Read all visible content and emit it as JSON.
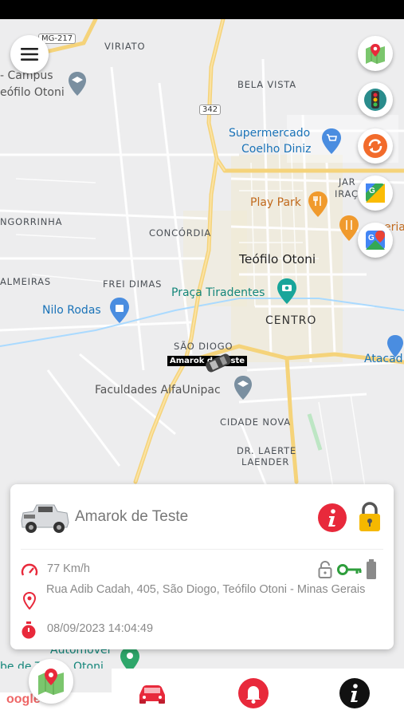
{
  "map": {
    "labels": {
      "viriato": "VIRIATO",
      "campus": "- Campus",
      "teofilo_campus": "eófilo Otoni",
      "bela_vista": "BELA VISTA",
      "supermercado": "Supermercado",
      "coelho_diniz": "Coelho Diniz",
      "jar": "JAR",
      "irac": "IRAÇ",
      "play_park": "Play Park",
      "ngorrinha": "NGORRINHA",
      "concordia": "CONCÓRDIA",
      "teofilo_otoni": "Teófilo Otoni",
      "almeiras": "ALMEIRAS",
      "frei_dimas": "FREI DIMAS",
      "praca": "Praça Tiradentes",
      "nilo_rodas": "Nilo Rodas",
      "centro": "CENTRO",
      "sao_diogo": "SÃO DIOGO",
      "atacad": "Atacad",
      "faculdades": "Faculdades AlfaUnipac",
      "cidade_nova": "CIDADE NOVA",
      "dr_laerte": "DR. LAERTE",
      "laender": "LAENDER",
      "eria": "eria",
      "automovel": "Automovel",
      "be_de": "be de T",
      "otoni_bottom": "Otoni",
      "google": "oogle"
    },
    "shields": {
      "mg217": "MG-217",
      "r342": "342"
    },
    "car_label": "Amarok de Teste"
  },
  "vehicle": {
    "name": "Amarok de Teste",
    "speed": "77 Km/h",
    "address": "Rua Adib Cadah, 405, São Diogo, Teófilo Otoni - Minas Gerais",
    "datetime": "08/09/2023 14:04:49"
  },
  "colors": {
    "accent_red": "#e8293b",
    "lock_yellow": "#f5b800",
    "key_green": "#2e9e3c",
    "road_yellow": "#f5d37a",
    "bell_red": "#e8293b"
  },
  "icons": [
    "menu-icon",
    "maps-icon",
    "traffic-light-icon",
    "refresh-icon",
    "google-maps-icon",
    "google-maps-alt-icon",
    "info-icon",
    "padlock-icon",
    "speedometer-icon",
    "unlock-icon",
    "key-icon",
    "battery-icon",
    "location-pin-icon",
    "stopwatch-icon",
    "car-icon",
    "bell-icon"
  ]
}
